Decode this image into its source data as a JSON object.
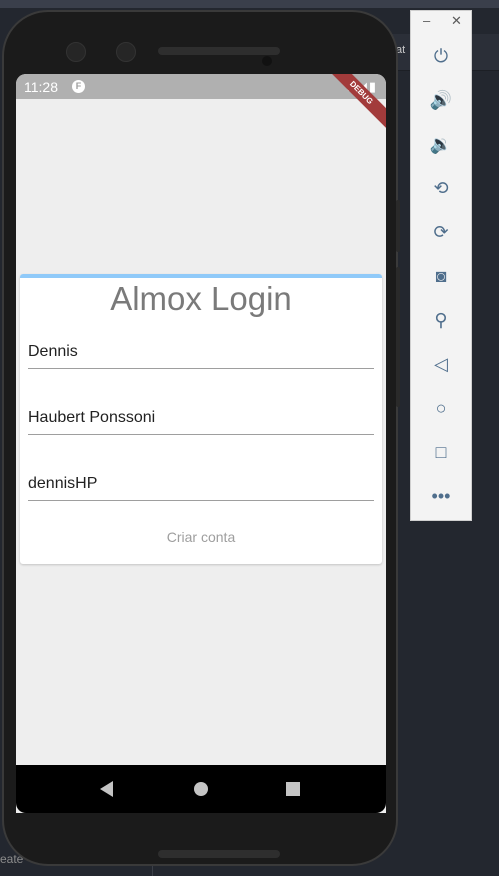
{
  "ide": {
    "tab_fragment": "at",
    "bottom_fragment": "eate"
  },
  "status_bar": {
    "time": "11:28",
    "app_badge": "F",
    "debug_label": "DEBUG"
  },
  "app": {
    "title": "Almox Login",
    "fields": [
      {
        "value": "Dennis"
      },
      {
        "value": "Haubert Ponssoni"
      },
      {
        "value": "dennisHP"
      }
    ],
    "create_account_label": "Criar conta"
  },
  "colors": {
    "progress_bar": "#90caf9",
    "title_text": "#7a7a7a",
    "debug_ribbon": "#a23b3b"
  },
  "emulator_panel": {
    "window_controls": [
      "minimize",
      "close"
    ],
    "buttons": [
      "power-icon",
      "volume-up-icon",
      "volume-down-icon",
      "rotate-left-icon",
      "rotate-right-icon",
      "camera-icon",
      "zoom-icon",
      "back-icon",
      "home-icon",
      "overview-icon",
      "more-icon"
    ]
  },
  "nav_bar": [
    "back",
    "home",
    "recents"
  ]
}
